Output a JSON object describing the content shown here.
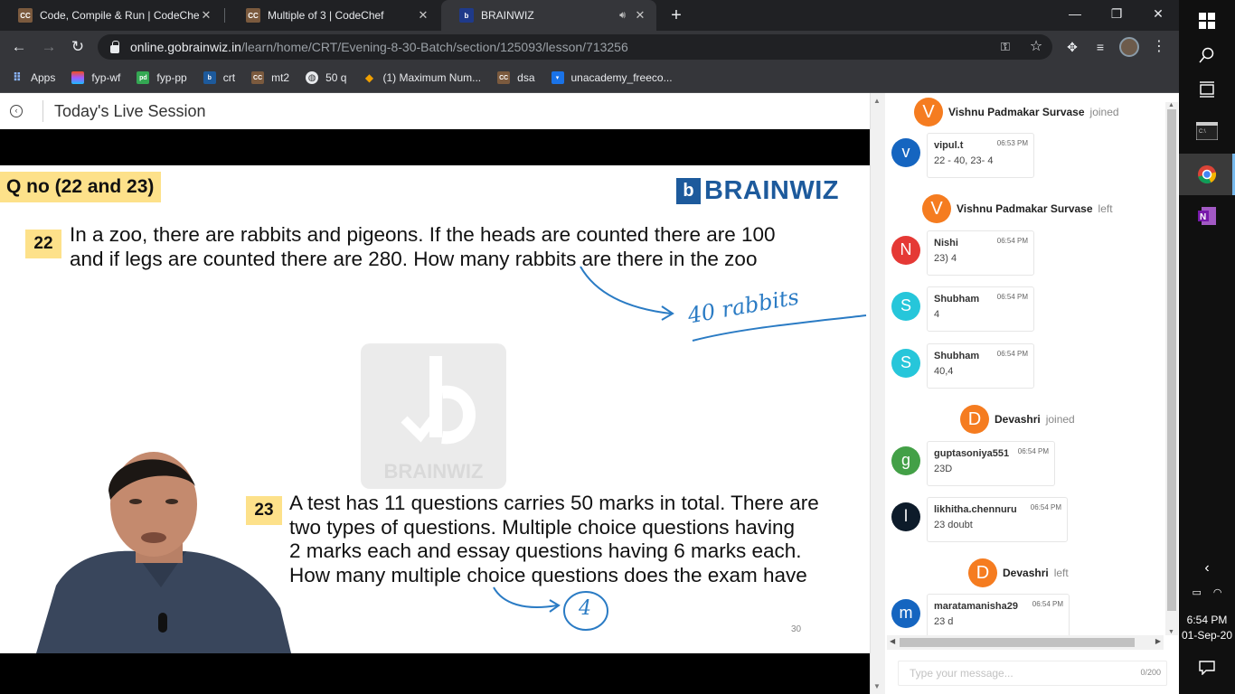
{
  "browser": {
    "tabs": [
      {
        "title": "Code, Compile & Run | CodeChef",
        "favicon": "CC"
      },
      {
        "title": "Multiple of 3 | CodeChef",
        "favicon": "CC"
      },
      {
        "title": "BRAINWIZ",
        "favicon": "b"
      }
    ],
    "address": {
      "host": "online.gobrainwiz.in",
      "path": "/learn/home/CRT/Evening-8-30-Batch/section/125093/lesson/713256"
    },
    "bookmarks": [
      {
        "label": "Apps",
        "icon": "apps-grid-icon"
      },
      {
        "label": "fyp-wf",
        "icon": "figma-icon"
      },
      {
        "label": "fyp-pp",
        "icon": "pd-icon"
      },
      {
        "label": "crt",
        "icon": "brainwiz-icon"
      },
      {
        "label": "mt2",
        "icon": "codechef-icon"
      },
      {
        "label": "50 q",
        "icon": "globe-icon"
      },
      {
        "label": "(1) Maximum Num...",
        "icon": "hackerrank-icon"
      },
      {
        "label": "dsa",
        "icon": "codechef-icon"
      },
      {
        "label": "unacademy_freeco...",
        "icon": "unacademy-icon"
      }
    ]
  },
  "page": {
    "title": "Today's Live Session"
  },
  "slide": {
    "tag": "Q no (22 and 23)",
    "logo": "BRAINWIZ",
    "watermark": "BRAINWIZ",
    "q22": {
      "num": "22",
      "line1": "In a zoo, there are rabbits and pigeons. If the heads are counted there are 100",
      "line2": "and if legs are counted there are 280. How many rabbits are there in the zoo",
      "answer": "40 rabbits"
    },
    "q23": {
      "num": "23",
      "line1": "A test has 11 questions carries 50 marks in total. There are",
      "line2": "two types of questions. Multiple choice questions having",
      "line3": "2 marks each and essay questions having 6 marks each.",
      "line4": "How many multiple choice questions does the exam have",
      "answer": "4"
    },
    "page_number": "30"
  },
  "chat": {
    "events": [
      {
        "initial": "V",
        "name": "Vishnu Padmakar Survase",
        "action": "joined"
      },
      {
        "initial": "V",
        "name": "Vishnu Padmakar Survase",
        "action": "left"
      },
      {
        "initial": "D",
        "name": "Devashri",
        "action": "joined"
      },
      {
        "initial": "D",
        "name": "Devashri",
        "action": "left"
      }
    ],
    "messages": [
      {
        "initial": "v",
        "user": "vipul.t",
        "time": "06:53 PM",
        "text": "22 - 40, 23- 4",
        "color": "#1565c0"
      },
      {
        "initial": "N",
        "user": "Nishi",
        "time": "06:54 PM",
        "text": "23) 4",
        "color": "#e53935"
      },
      {
        "initial": "S",
        "user": "Shubham",
        "time": "06:54 PM",
        "text": "4",
        "color": "#26c6da"
      },
      {
        "initial": "S",
        "user": "Shubham",
        "time": "06:54 PM",
        "text": "40,4",
        "color": "#26c6da"
      },
      {
        "initial": "g",
        "user": "guptasoniya551",
        "time": "06:54 PM",
        "text": "23D",
        "color": "#43a047"
      },
      {
        "initial": "l",
        "user": "likhitha.chennuru",
        "time": "06:54 PM",
        "text": "23 doubt",
        "color": "#0d1b2a"
      },
      {
        "initial": "m",
        "user": "maratamanisha29",
        "time": "06:54 PM",
        "text": "23 d",
        "color": "#1565c0"
      }
    ],
    "input_placeholder": "Type your message...",
    "char_count": "0/200"
  },
  "taskbar": {
    "time": "6:54 PM",
    "date": "01-Sep-20"
  }
}
